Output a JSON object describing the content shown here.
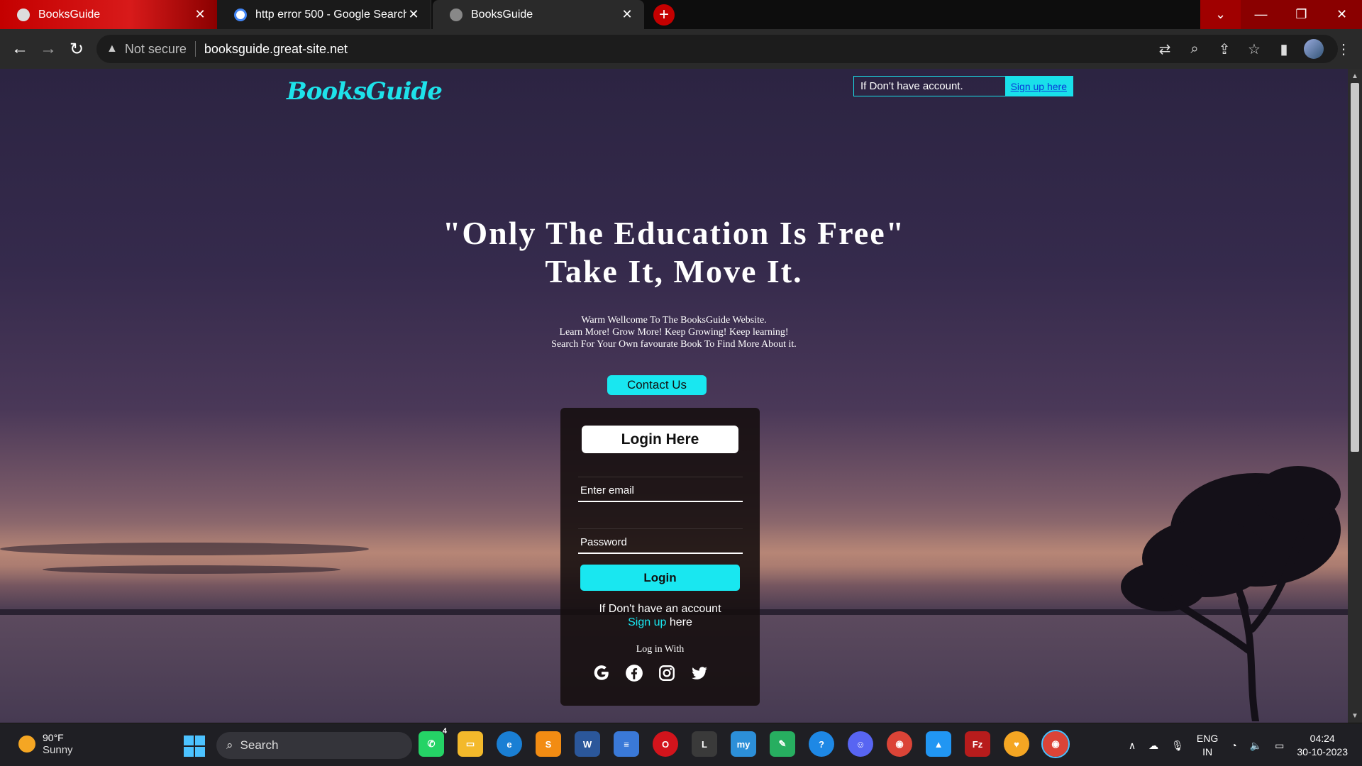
{
  "browser": {
    "tabs": [
      {
        "title": "BooksGuide"
      },
      {
        "title": "http error 500 - Google Search"
      },
      {
        "title": "BooksGuide"
      }
    ],
    "address": {
      "security": "Not secure",
      "url": "booksguide.great-site.net"
    }
  },
  "site": {
    "logo": "BooksGuide",
    "header_signup": {
      "prompt": "If Don't have account.",
      "link": "Sign up here"
    },
    "hero": {
      "line1": "\"Only The Education Is Free\"",
      "line2": "Take It, Move It."
    },
    "subtitle": {
      "line1": "Warm Wellcome To The BooksGuide Website.",
      "line2": "Learn More! Grow More! Keep Growing! Keep learning!",
      "line3": "Search For Your Own favourate Book To Find More About it."
    },
    "contact_button": "Contact Us",
    "login": {
      "title": "Login Here",
      "email_placeholder": "Enter email",
      "password_placeholder": "Password",
      "submit": "Login",
      "account_prompt": "If Don't have an account",
      "signup_link": "Sign up",
      "signup_suffix": " here",
      "login_with": "Log in With",
      "socials": [
        "google-icon",
        "facebook-icon",
        "instagram-icon",
        "twitter-icon"
      ]
    }
  },
  "taskbar": {
    "weather": {
      "temp": "90°F",
      "condition": "Sunny"
    },
    "search_placeholder": "Search",
    "whatsapp_badge": "4",
    "tray": {
      "lang_top": "ENG",
      "lang_bottom": "IN",
      "time": "04:24",
      "date": "30-10-2023"
    }
  },
  "colors": {
    "accent": "#19e7f0",
    "tab_active_red": "#c40000"
  }
}
